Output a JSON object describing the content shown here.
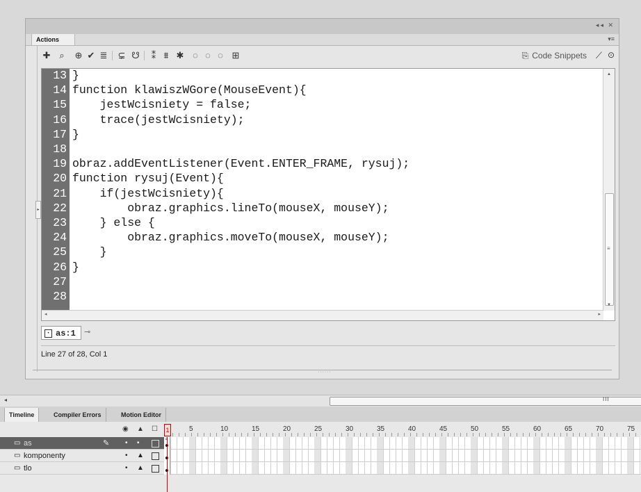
{
  "actions_panel": {
    "tab_label": "Actions",
    "panel_controls": "◂◂ ✕",
    "panel_menu": "▾≡",
    "toolbar": {
      "icons": [
        "add-statement-icon",
        "find-icon",
        "target-path-icon",
        "check-syntax-icon",
        "auto-format-icon",
        "code-hint-icon",
        "debug-options-icon",
        "collapse-between-braces-icon",
        "collapse-selection-icon",
        "expand-all-icon",
        "apply-block-comment-icon",
        "apply-line-comment-icon",
        "remove-comment-icon",
        "show-hide-toolbox-icon"
      ],
      "code_snippets_label": "Code Snippets"
    },
    "code_lines": [
      {
        "num": "13",
        "text": "}"
      },
      {
        "num": "14",
        "text": "function klawiszWGore(MouseEvent){"
      },
      {
        "num": "15",
        "text": "    jestWcisniety = false;"
      },
      {
        "num": "16",
        "text": "    trace(jestWcisniety);"
      },
      {
        "num": "17",
        "text": "}"
      },
      {
        "num": "18",
        "text": ""
      },
      {
        "num": "19",
        "text": "obraz.addEventListener(Event.ENTER_FRAME, rysuj);"
      },
      {
        "num": "20",
        "text": "function rysuj(Event){"
      },
      {
        "num": "21",
        "text": "    if(jestWcisniety){"
      },
      {
        "num": "22",
        "text": "        obraz.graphics.lineTo(mouseX, mouseY);"
      },
      {
        "num": "23",
        "text": "    } else {"
      },
      {
        "num": "24",
        "text": "        obraz.graphics.moveTo(mouseX, mouseY);"
      },
      {
        "num": "25",
        "text": "    }"
      },
      {
        "num": "26",
        "text": "}"
      },
      {
        "num": "27",
        "text": ""
      },
      {
        "num": "28",
        "text": ""
      }
    ],
    "script_tab_label": "as:1",
    "status": "Line 27 of 28, Col 1"
  },
  "timeline": {
    "tabs": [
      "Timeline",
      "Compiler Errors",
      "Motion Editor"
    ],
    "active_tab": "Timeline",
    "current_frame": "1",
    "frame_numbers": [
      "5",
      "10",
      "15",
      "20",
      "25",
      "30",
      "35",
      "40",
      "45",
      "50",
      "55",
      "60",
      "65",
      "70",
      "75"
    ],
    "layers": [
      {
        "name": "as",
        "selected": true,
        "has_actions": true
      },
      {
        "name": "komponenty",
        "selected": false,
        "has_actions": false
      },
      {
        "name": "tlo",
        "selected": false,
        "has_actions": false
      }
    ]
  },
  "colors": {
    "gutter": "#707070",
    "selected_layer": "#606060",
    "playhead": "#cc0000"
  }
}
